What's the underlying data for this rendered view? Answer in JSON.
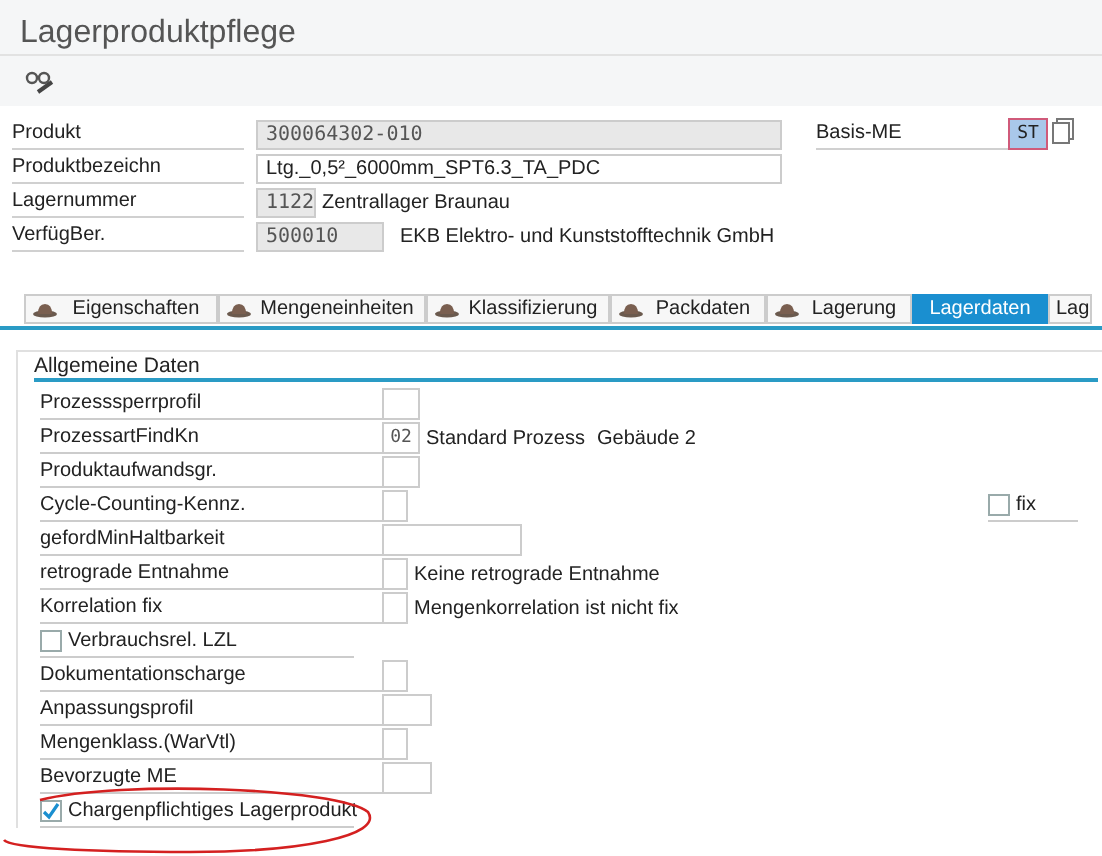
{
  "window": {
    "title": "Lagerproduktpflege"
  },
  "header_fields": [
    {
      "label": "Produkt",
      "value": "300064302-010",
      "kind": "readonly"
    },
    {
      "label": "Produktbezeichn",
      "value": "Ltg._0,5²_6000mm_SPT6.3_TA_PDC",
      "kind": "text"
    },
    {
      "label": "Lagernummer",
      "value": "1122",
      "kind": "short",
      "description": "Zentrallager Braunau"
    },
    {
      "label": "VerfügBer.",
      "value": "500010",
      "kind": "medium",
      "description": "EKB Elektro- und Kunststofftechnik GmbH"
    }
  ],
  "basis_me": {
    "label": "Basis-ME",
    "value": "ST"
  },
  "tabs": [
    {
      "label": "Eigenschaften",
      "selected": false
    },
    {
      "label": "Mengeneinheiten",
      "selected": false
    },
    {
      "label": "Klassifizierung",
      "selected": false
    },
    {
      "label": "Packdaten",
      "selected": false
    },
    {
      "label": "Lagerung",
      "selected": false
    },
    {
      "label": "Lagerdaten",
      "selected": true
    },
    {
      "label": "Lag",
      "selected": false
    }
  ],
  "section": {
    "title": "Allgemeine Daten",
    "rows": [
      {
        "kind": "field",
        "label": "Prozesssperrprofil"
      },
      {
        "kind": "field",
        "label": "ProzessartFindKn",
        "value": "02",
        "descriptions": [
          "Standard Prozess",
          "Gebäude 2"
        ]
      },
      {
        "kind": "field",
        "label": "Produktaufwandsgr."
      },
      {
        "kind": "field",
        "label": "Cycle-Counting-Kennz.",
        "side_checkbox": {
          "label": "fix",
          "checked": false
        }
      },
      {
        "kind": "field",
        "label": "gefordMinHaltbarkeit"
      },
      {
        "kind": "field",
        "label": "retrograde Entnahme",
        "descriptions": [
          "Keine retrograde Entnahme"
        ]
      },
      {
        "kind": "field",
        "label": "Korrelation fix",
        "descriptions": [
          "Mengenkorrelation ist nicht fix"
        ]
      },
      {
        "kind": "checkbox",
        "label": "Verbrauchsrel. LZL",
        "checked": false
      },
      {
        "kind": "field",
        "label": "Dokumentationscharge"
      },
      {
        "kind": "field",
        "label": "Anpassungsprofil"
      },
      {
        "kind": "field",
        "label": "Mengenklass.(WarVtl)"
      },
      {
        "kind": "field",
        "label": "Bevorzugte ME"
      },
      {
        "kind": "checkbox",
        "label": "Chargenpflichtiges Lagerprodukt",
        "checked": true
      }
    ]
  }
}
